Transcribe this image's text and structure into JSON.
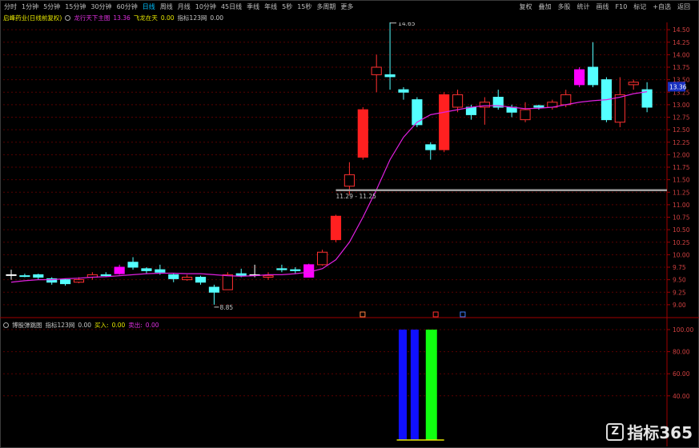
{
  "toolbar": {
    "tabs": [
      "分时",
      "1分钟",
      "5分钟",
      "15分钟",
      "30分钟",
      "60分钟",
      "日线",
      "周线",
      "月线",
      "10分钟",
      "45日线",
      "季线",
      "年线",
      "5秒",
      "15秒",
      "多周期",
      "更多"
    ],
    "active_tab": 6,
    "right_tabs": [
      "复权",
      "叠加",
      "多股",
      "统计",
      "画线",
      "F10",
      "标记",
      "+自选",
      "返回"
    ]
  },
  "info": {
    "stock": "启峰药业(日线前复权)",
    "indicator_name": "龙行天下主图",
    "price": "13.36",
    "label": "飞龙在天",
    "v1": "0.00",
    "index_label": "指标123网",
    "v2": "0.00"
  },
  "price_axis": {
    "ticks": [
      "14.50",
      "14.25",
      "14.00",
      "13.75",
      "13.50",
      "13.25",
      "13.00",
      "12.75",
      "12.50",
      "12.25",
      "12.00",
      "11.75",
      "11.50",
      "11.25",
      "11.00",
      "10.75",
      "10.50",
      "10.25",
      "10.00",
      "9.75",
      "9.50",
      "9.25",
      "9.00"
    ],
    "current": "13.36"
  },
  "annotations": {
    "high": "14.65",
    "low": "8.85",
    "range": "11.29 - 11.25"
  },
  "sub_panel": {
    "title": "博股弹跳图",
    "index_label": "指标123网",
    "v1": "0.00",
    "buy_label": "买入:",
    "buy": "0.00",
    "sell_label": "卖出:",
    "sell": "0.00",
    "ticks": [
      "100.00",
      "80.00",
      "60.00",
      "40.00"
    ]
  },
  "chart_data": {
    "type": "candlestick",
    "candles": [
      {
        "o": 9.6,
        "c": 9.6,
        "h": 9.7,
        "l": 9.5,
        "col": "w"
      },
      {
        "o": 9.58,
        "c": 9.58,
        "h": 9.62,
        "l": 9.55,
        "col": "c"
      },
      {
        "o": 9.6,
        "c": 9.55,
        "h": 9.62,
        "l": 9.5,
        "col": "c"
      },
      {
        "o": 9.52,
        "c": 9.45,
        "h": 9.55,
        "l": 9.4,
        "col": "c"
      },
      {
        "o": 9.5,
        "c": 9.42,
        "h": 9.52,
        "l": 9.38,
        "col": "c"
      },
      {
        "o": 9.45,
        "c": 9.5,
        "h": 9.55,
        "l": 9.43,
        "col": "r"
      },
      {
        "o": 9.55,
        "c": 9.6,
        "h": 9.65,
        "l": 9.5,
        "col": "r"
      },
      {
        "o": 9.6,
        "c": 9.58,
        "h": 9.65,
        "l": 9.55,
        "col": "c"
      },
      {
        "o": 9.62,
        "c": 9.75,
        "h": 9.8,
        "l": 9.6,
        "col": "m"
      },
      {
        "o": 9.85,
        "c": 9.75,
        "h": 9.95,
        "l": 9.7,
        "col": "c"
      },
      {
        "o": 9.72,
        "c": 9.68,
        "h": 9.75,
        "l": 9.62,
        "col": "c"
      },
      {
        "o": 9.7,
        "c": 9.65,
        "h": 9.8,
        "l": 9.6,
        "col": "c"
      },
      {
        "o": 9.6,
        "c": 9.52,
        "h": 9.62,
        "l": 9.45,
        "col": "c"
      },
      {
        "o": 9.5,
        "c": 9.55,
        "h": 9.6,
        "l": 9.48,
        "col": "r"
      },
      {
        "o": 9.55,
        "c": 9.45,
        "h": 9.58,
        "l": 9.4,
        "col": "c"
      },
      {
        "o": 9.35,
        "c": 9.25,
        "h": 9.4,
        "l": 9.0,
        "col": "c"
      },
      {
        "o": 9.3,
        "c": 9.6,
        "h": 9.65,
        "l": 9.3,
        "col": "r"
      },
      {
        "o": 9.62,
        "c": 9.58,
        "h": 9.72,
        "l": 9.55,
        "col": "c"
      },
      {
        "o": 9.6,
        "c": 9.6,
        "h": 9.8,
        "l": 9.55,
        "col": "w"
      },
      {
        "o": 9.55,
        "c": 9.58,
        "h": 9.65,
        "l": 9.5,
        "col": "r"
      },
      {
        "o": 9.72,
        "c": 9.7,
        "h": 9.8,
        "l": 9.65,
        "col": "c"
      },
      {
        "o": 9.7,
        "c": 9.68,
        "h": 9.75,
        "l": 9.62,
        "col": "c"
      },
      {
        "o": 9.55,
        "c": 9.8,
        "h": 9.82,
        "l": 9.55,
        "col": "m"
      },
      {
        "o": 9.8,
        "c": 10.05,
        "h": 10.1,
        "l": 9.78,
        "col": "r"
      },
      {
        "o": 10.3,
        "c": 10.77,
        "h": 10.8,
        "l": 10.25,
        "col": "rf"
      },
      {
        "o": 11.37,
        "c": 11.6,
        "h": 11.85,
        "l": 11.2,
        "col": "r"
      },
      {
        "o": 11.95,
        "c": 12.9,
        "h": 12.95,
        "l": 11.9,
        "col": "rf"
      },
      {
        "o": 13.75,
        "c": 13.6,
        "h": 14.0,
        "l": 13.25,
        "col": "r"
      },
      {
        "o": 13.6,
        "c": 13.56,
        "h": 14.65,
        "l": 13.3,
        "col": "c"
      },
      {
        "o": 13.3,
        "c": 13.25,
        "h": 13.35,
        "l": 13.1,
        "col": "c"
      },
      {
        "o": 13.1,
        "c": 12.6,
        "h": 13.15,
        "l": 12.55,
        "col": "c"
      },
      {
        "o": 12.2,
        "c": 12.1,
        "h": 12.25,
        "l": 11.9,
        "col": "c"
      },
      {
        "o": 12.1,
        "c": 13.2,
        "h": 13.25,
        "l": 12.05,
        "col": "rf"
      },
      {
        "o": 12.95,
        "c": 13.2,
        "h": 13.3,
        "l": 12.85,
        "col": "r"
      },
      {
        "o": 12.95,
        "c": 12.8,
        "h": 13.0,
        "l": 12.7,
        "col": "c"
      },
      {
        "o": 13.05,
        "c": 12.95,
        "h": 13.15,
        "l": 12.6,
        "col": "r"
      },
      {
        "o": 13.15,
        "c": 12.95,
        "h": 13.3,
        "l": 12.9,
        "col": "c"
      },
      {
        "o": 12.95,
        "c": 12.85,
        "h": 13.0,
        "l": 12.75,
        "col": "c"
      },
      {
        "o": 12.7,
        "c": 12.9,
        "h": 13.05,
        "l": 12.65,
        "col": "r"
      },
      {
        "o": 12.98,
        "c": 12.95,
        "h": 13.0,
        "l": 12.9,
        "col": "c"
      },
      {
        "o": 12.95,
        "c": 13.05,
        "h": 13.1,
        "l": 12.9,
        "col": "r"
      },
      {
        "o": 13.0,
        "c": 13.2,
        "h": 13.3,
        "l": 12.95,
        "col": "r"
      },
      {
        "o": 13.7,
        "c": 13.4,
        "h": 13.75,
        "l": 13.35,
        "col": "mf"
      },
      {
        "o": 13.75,
        "c": 13.4,
        "h": 14.25,
        "l": 13.35,
        "col": "c"
      },
      {
        "o": 13.5,
        "c": 12.7,
        "h": 13.55,
        "l": 12.65,
        "col": "c"
      },
      {
        "o": 12.65,
        "c": 13.2,
        "h": 13.55,
        "l": 12.55,
        "col": "r"
      },
      {
        "o": 13.45,
        "c": 13.4,
        "h": 13.5,
        "l": 13.3,
        "col": "r"
      },
      {
        "o": 13.3,
        "c": 12.95,
        "h": 13.45,
        "l": 12.85,
        "col": "c"
      }
    ],
    "ma": [
      9.45,
      9.48,
      9.5,
      9.5,
      9.52,
      9.53,
      9.55,
      9.56,
      9.58,
      9.6,
      9.62,
      9.63,
      9.63,
      9.62,
      9.62,
      9.6,
      9.58,
      9.57,
      9.58,
      9.6,
      9.6,
      9.62,
      9.65,
      9.72,
      9.9,
      10.25,
      10.75,
      11.3,
      11.9,
      12.35,
      12.65,
      12.8,
      12.85,
      12.9,
      12.95,
      12.98,
      12.98,
      12.95,
      12.92,
      12.93,
      12.95,
      13.0,
      13.05,
      13.08,
      13.1,
      13.15,
      13.22,
      13.26
    ],
    "sub_bars": [
      {
        "index": 29,
        "value": 100,
        "color": "#1010ff"
      },
      {
        "index": 30,
        "value": 100,
        "color": "#1010ff"
      },
      {
        "index": 31,
        "value": 100,
        "color": "#10ff10"
      }
    ]
  },
  "watermark": "指标365"
}
